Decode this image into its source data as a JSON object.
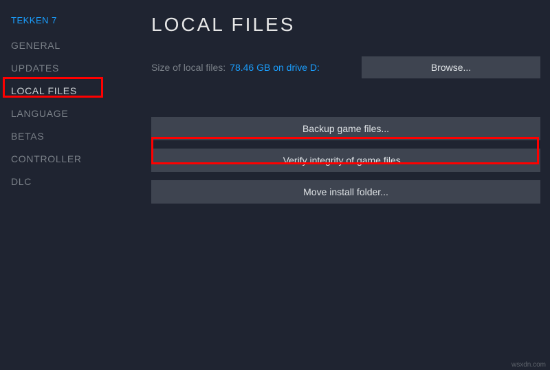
{
  "game_title": "TEKKEN 7",
  "sidebar": {
    "items": [
      {
        "label": "GENERAL",
        "active": false
      },
      {
        "label": "UPDATES",
        "active": false
      },
      {
        "label": "LOCAL FILES",
        "active": true
      },
      {
        "label": "LANGUAGE",
        "active": false
      },
      {
        "label": "BETAS",
        "active": false
      },
      {
        "label": "CONTROLLER",
        "active": false
      },
      {
        "label": "DLC",
        "active": false
      }
    ]
  },
  "main": {
    "title": "LOCAL FILES",
    "size_label": "Size of local files:",
    "size_value": "78.46 GB on drive D:",
    "browse_label": "Browse...",
    "actions": {
      "backup": "Backup game files...",
      "verify": "Verify integrity of game files...",
      "move": "Move install folder..."
    }
  },
  "watermark": "wsxdn.com"
}
